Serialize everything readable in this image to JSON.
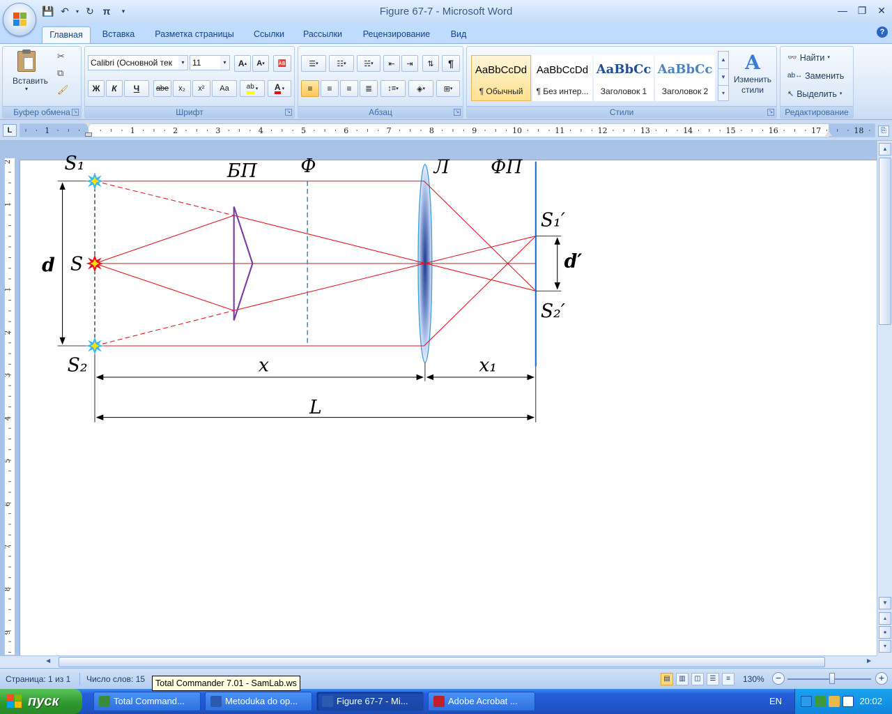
{
  "window": {
    "title": "Figure 67-7 - Microsoft Word"
  },
  "qat_icons": [
    "save-icon",
    "undo-icon",
    "redo-icon",
    "pi-icon",
    "customize-icon"
  ],
  "tabs": [
    {
      "label": "Главная",
      "active": true
    },
    {
      "label": "Вставка"
    },
    {
      "label": "Разметка страницы"
    },
    {
      "label": "Ссылки"
    },
    {
      "label": "Рассылки"
    },
    {
      "label": "Рецензирование"
    },
    {
      "label": "Вид"
    }
  ],
  "ribbon": {
    "clipboard": {
      "label": "Буфер обмена",
      "paste_label": "Вставить"
    },
    "font": {
      "label": "Шрифт",
      "font_name": "Calibri (Основной тек",
      "font_size": "11",
      "bold": "Ж",
      "italic": "К",
      "underline": "Ч",
      "strike": "abe",
      "sub": "x₂",
      "sup": "x²",
      "case": "Aa"
    },
    "paragraph": {
      "label": "Абзац"
    },
    "styles": {
      "label": "Стили",
      "items": [
        {
          "preview": "AaBbCcDd",
          "name": "¶ Обычный",
          "selected": true
        },
        {
          "preview": "AaBbCcDd",
          "name": "¶ Без интер..."
        },
        {
          "preview": "AaBbCc",
          "name": "Заголовок 1"
        },
        {
          "preview": "AaBbCc",
          "name": "Заголовок 2"
        }
      ],
      "change_styles": "Изменить стили"
    },
    "editing": {
      "label": "Редактирование",
      "find": "Найти",
      "replace": "Заменить",
      "select": "Выделить"
    }
  },
  "ruler": {
    "corner": "L",
    "numbers": [
      "1",
      "1",
      "2",
      "3",
      "4",
      "5",
      "6",
      "7",
      "8",
      "9",
      "10",
      "11",
      "12",
      "13",
      "14",
      "15",
      "16",
      "17",
      "18"
    ],
    "v_numbers": [
      "2",
      "1",
      "1",
      "2",
      "3",
      "4",
      "5",
      "6",
      "7",
      "8",
      "9"
    ]
  },
  "diagram": {
    "labels": {
      "s1": "S₁",
      "s": "S",
      "s2": "S₂",
      "d": "d",
      "bp": "БП",
      "f": "Ф",
      "lens": "Л",
      "fp": "ФП",
      "s1p": "S₁′",
      "s2p": "S₂′",
      "dp": "d′",
      "x": "x",
      "x1": "x₁",
      "L": "L"
    },
    "colors": {
      "ray": "#e8101a",
      "prism": "#7a3aa0",
      "dashed_f": "#2a7fd0",
      "fp_line": "#1a6fd0",
      "lens": "#4a6fb5"
    }
  },
  "status": {
    "page": "Страница: 1 из 1",
    "words": "Число слов: 15",
    "tooltip": "Total Commander 7.01 - SamLab.ws",
    "zoom": "130%"
  },
  "taskbar": {
    "start": "пуск",
    "tasks": [
      {
        "label": "Total Command...",
        "icon_color": "#3c8a3c"
      },
      {
        "label": "Metoduka do op...",
        "icon_color": "#2a5bb0"
      },
      {
        "label": "Figure 67-7 - Mi...",
        "icon_color": "#2a5bb0",
        "active": true
      },
      {
        "label": "Adobe Acrobat ...",
        "icon_color": "#c0202a"
      }
    ],
    "lang": "EN",
    "clock": "20:02"
  }
}
